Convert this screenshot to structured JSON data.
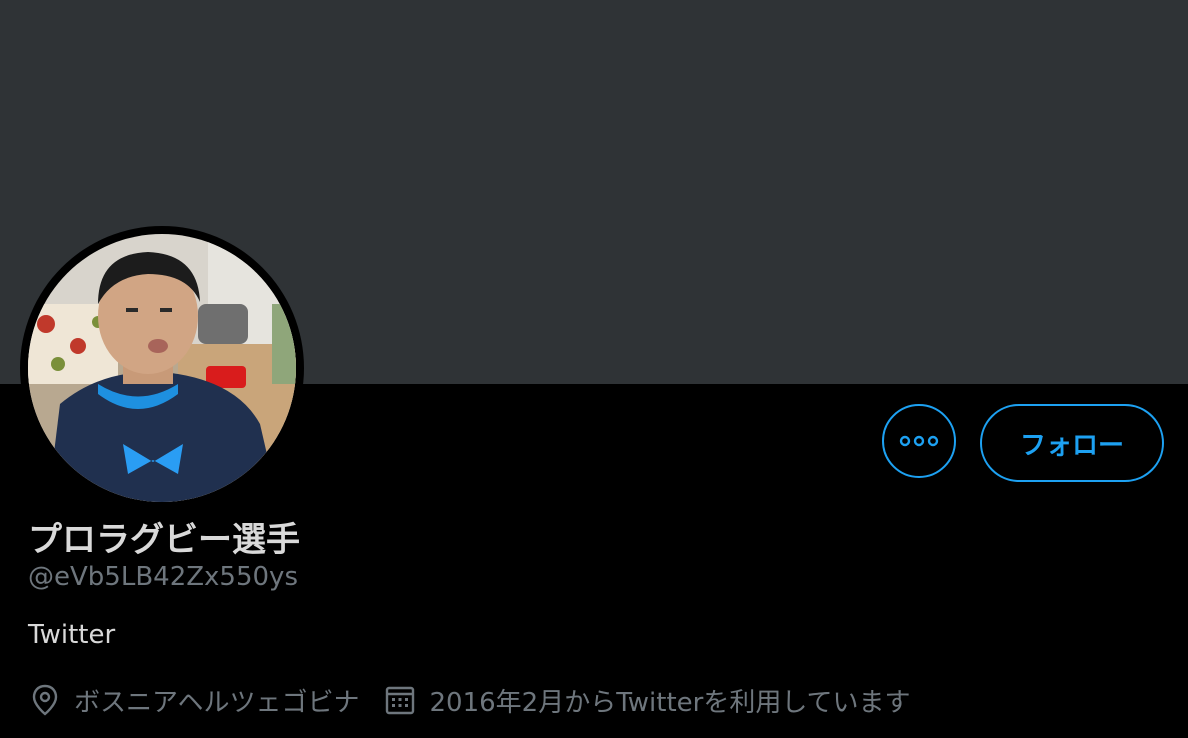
{
  "colors": {
    "banner": "#2f3336",
    "background": "#000000",
    "accent": "#1da1f2",
    "primary_text": "#d9d9d9",
    "secondary_text": "#6e767d"
  },
  "profile": {
    "display_name": "プロラグビー選手",
    "handle": "@eVb5LB42Zx550ys",
    "bio": "Twitter",
    "location": "ボスニアヘルツェゴビナ",
    "joined": "2016年2月からTwitterを利用しています"
  },
  "actions": {
    "more_icon": "more-horizontal-icon",
    "follow_label": "フォロー"
  },
  "icons": {
    "location": "location-pin-icon",
    "joined": "calendar-icon"
  }
}
